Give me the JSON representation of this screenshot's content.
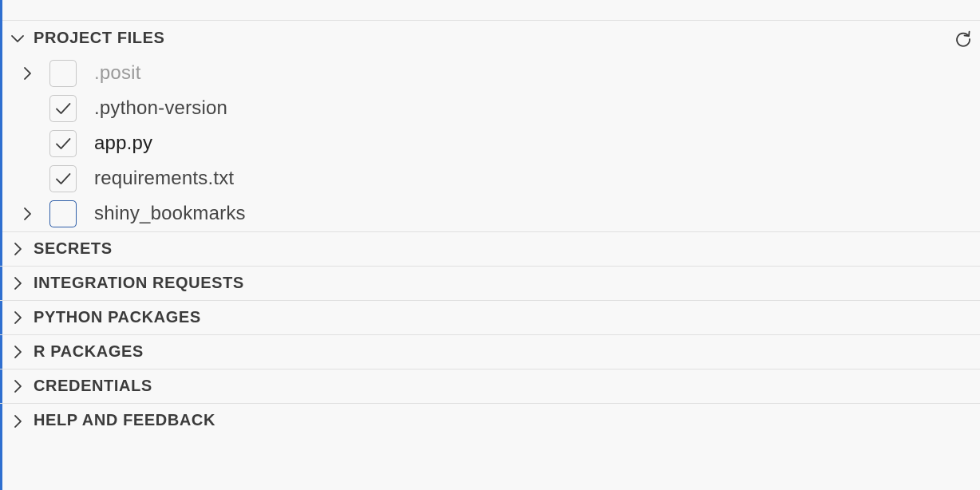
{
  "project_files": {
    "title": "PROJECT FILES",
    "refresh_icon": "refresh-icon",
    "items": [
      {
        "label": ".posit",
        "checked": false,
        "expandable": true,
        "state": "dim"
      },
      {
        "label": ".python-version",
        "checked": true,
        "expandable": false,
        "state": "normal"
      },
      {
        "label": "app.py",
        "checked": true,
        "expandable": false,
        "state": "dark"
      },
      {
        "label": "requirements.txt",
        "checked": true,
        "expandable": false,
        "state": "normal"
      },
      {
        "label": "shiny_bookmarks",
        "checked": false,
        "expandable": true,
        "state": "focused"
      }
    ]
  },
  "sections": [
    {
      "title": "SECRETS"
    },
    {
      "title": "INTEGRATION REQUESTS"
    },
    {
      "title": "PYTHON PACKAGES"
    },
    {
      "title": "R PACKAGES"
    },
    {
      "title": "CREDENTIALS"
    },
    {
      "title": "HELP AND FEEDBACK"
    }
  ],
  "colors": {
    "background": "#f8f8f8",
    "accent": "#2f6fd0",
    "divider": "#e0e0e0",
    "checkbox_border": "#c8c8c8",
    "focus_border": "#2f5fa8"
  }
}
